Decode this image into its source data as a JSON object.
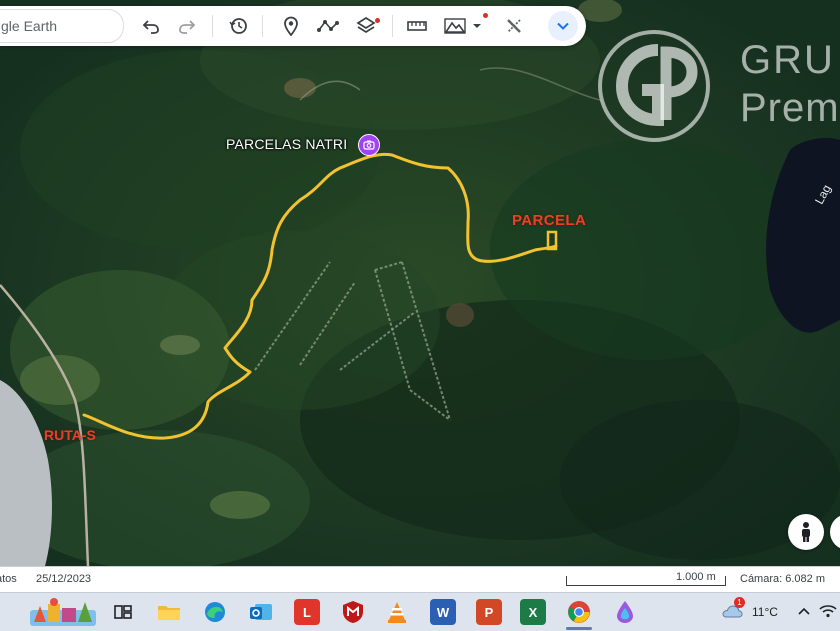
{
  "toolbar": {
    "search_text": "gle Earth",
    "icons": [
      "undo-icon",
      "redo-icon",
      "history-icon",
      "place-marker-icon",
      "path-icon",
      "layers-icon",
      "measure-icon",
      "map-style-icon",
      "tools-icon",
      "collapse-chevron-icon"
    ]
  },
  "map": {
    "place_label": "PARCELAS NATRI",
    "parcela_label": "PARCELA",
    "ruta_label": "RUTA-S",
    "lake_label": "Lag",
    "route_color": "#f2c230",
    "label_red": "#e8412a"
  },
  "watermark": {
    "line1": "GRU",
    "line2": "Prem"
  },
  "statusbar": {
    "data_label": "atos",
    "date": "25/12/2023",
    "scale": "1.000 m",
    "camera": "Cámara: 6.082 m"
  },
  "taskbar": {
    "apps": [
      "widgets-icon",
      "task-view-icon",
      "file-explorer-icon",
      "edge-icon",
      "outlook-icon",
      "app-l-icon",
      "mcafee-icon",
      "vlc-icon",
      "word-icon",
      "powerpoint-icon",
      "excel-icon",
      "chrome-icon",
      "copilot-icon"
    ],
    "word_letter": "W",
    "ppt_letter": "P",
    "excel_letter": "X",
    "l_letter": "L",
    "temperature": "11°C",
    "weather_badge": "1"
  }
}
